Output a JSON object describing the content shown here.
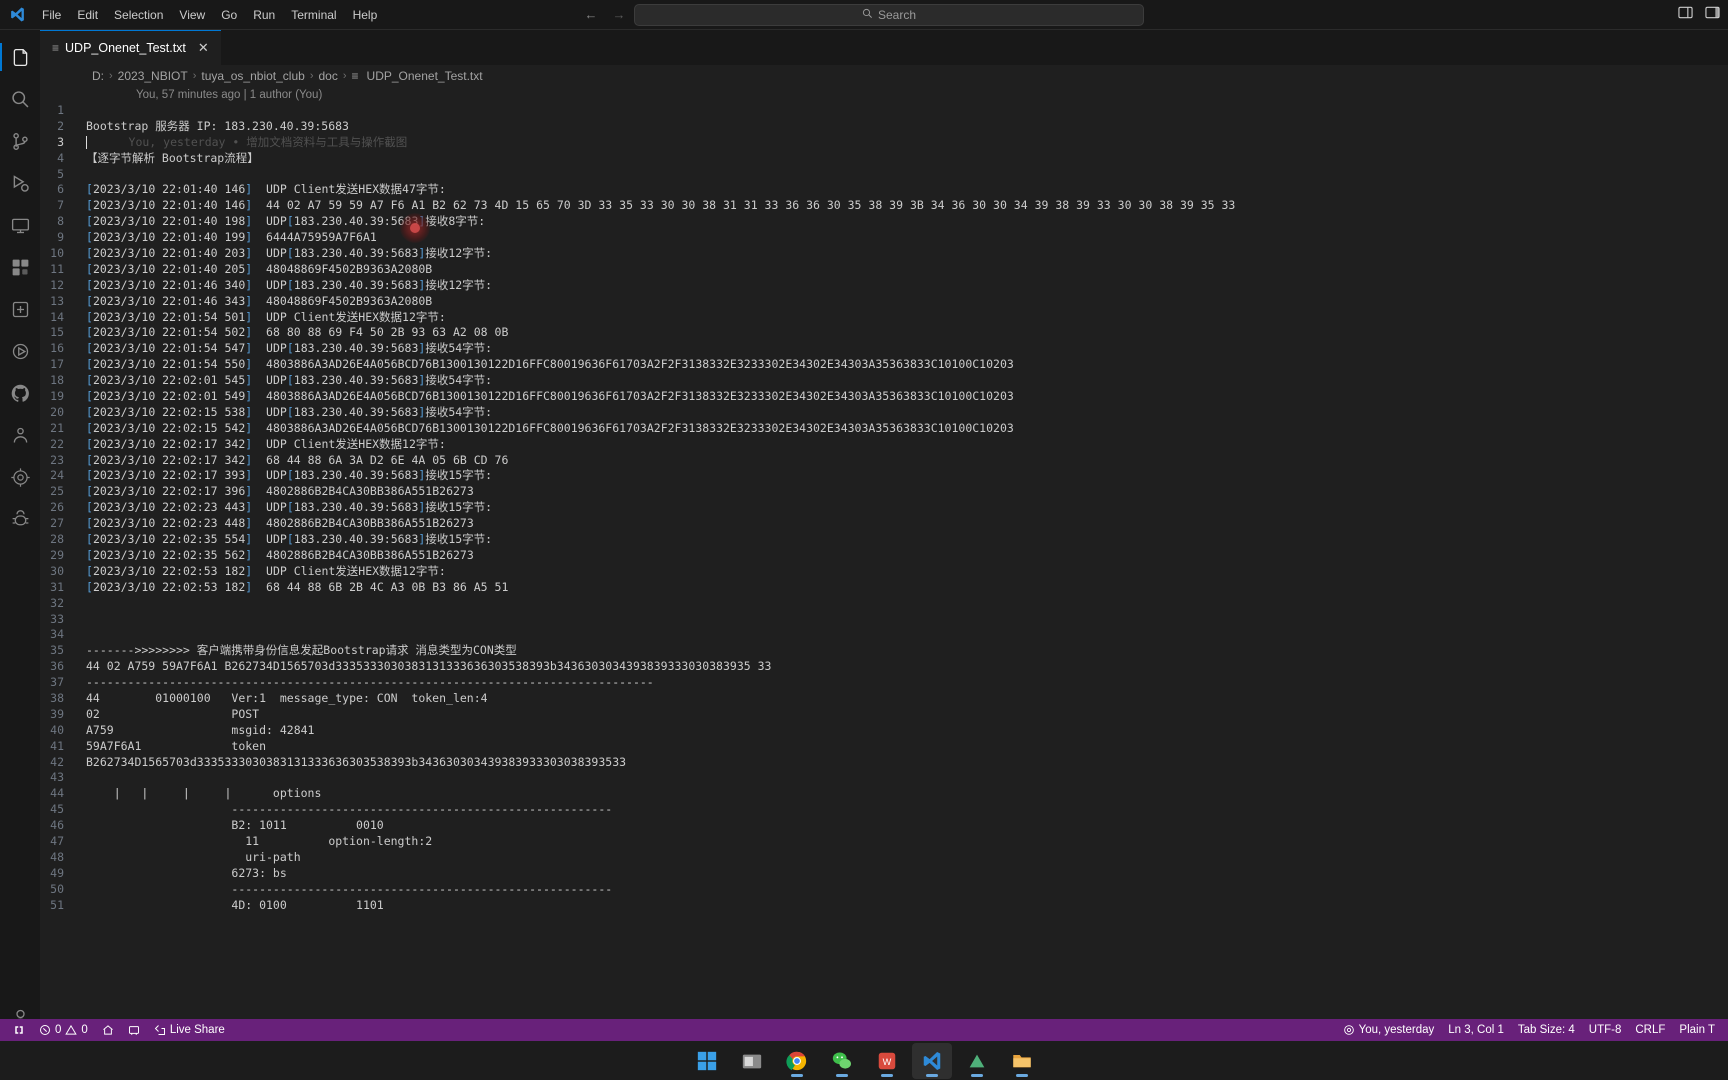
{
  "window": {
    "app": "Visual Studio Code"
  },
  "titlebar": {
    "menus": [
      "File",
      "Edit",
      "Selection",
      "View",
      "Go",
      "Run",
      "Terminal",
      "Help"
    ],
    "nav_back": "←",
    "nav_forward": "→",
    "search_placeholder": "Search",
    "search_icon": "search-icon",
    "layout_icon": "toggle-panel-icon",
    "customize_icon": "customize-layout-icon"
  },
  "activitybar": {
    "items": [
      {
        "name": "explorer",
        "icon": "files-icon",
        "active": true
      },
      {
        "name": "search",
        "icon": "search-icon",
        "active": false
      },
      {
        "name": "source-control",
        "icon": "source-control-icon",
        "active": false
      },
      {
        "name": "run-and-debug",
        "icon": "run-debug-icon",
        "active": false
      },
      {
        "name": "remote-explorer",
        "icon": "remote-explorer-icon",
        "active": false
      },
      {
        "name": "extensions",
        "icon": "extensions-icon",
        "active": false
      },
      {
        "name": "test-explorer",
        "icon": "beaker-icon",
        "active": false
      },
      {
        "name": "embedded-tools",
        "icon": "circuit-icon",
        "active": false
      },
      {
        "name": "github",
        "icon": "github-icon",
        "active": false
      },
      {
        "name": "live-share",
        "icon": "live-share-icon",
        "active": false
      },
      {
        "name": "platformio",
        "icon": "platformio-icon",
        "active": false
      },
      {
        "name": "code-runner",
        "icon": "bug-icon",
        "active": false
      }
    ],
    "bottom_items": [
      {
        "name": "accounts",
        "icon": "account-icon"
      },
      {
        "name": "manage",
        "icon": "gear-icon"
      }
    ]
  },
  "tabs": [
    {
      "label": "UDP_Onenet_Test.txt",
      "icon": "text-file-icon",
      "active": true,
      "close": "✕"
    }
  ],
  "breadcrumb": {
    "items": [
      "D:",
      "2023_NBIOT",
      "tuya_os_nbiot_club",
      "doc",
      "UDP_Onenet_Test.txt"
    ],
    "separator": "›",
    "file_icon": "text-file-icon"
  },
  "codelens": {
    "text": "You, 57 minutes ago | 1 author (You)"
  },
  "editor": {
    "blame_line3": "You, yesterday • 增加文档资料与工具与操作截图",
    "lines": [
      {
        "n": 1,
        "text": ""
      },
      {
        "n": 2,
        "text": "Bootstrap 服务器 IP: 183.230.40.39:5683"
      },
      {
        "n": 3,
        "text": "",
        "cursor": true
      },
      {
        "n": 4,
        "text": "【逐字节解析 Bootstrap流程】"
      },
      {
        "n": 5,
        "text": ""
      },
      {
        "n": 6,
        "text": "[2023/3/10 22:01:40 146]  UDP Client发送HEX数据47字节:"
      },
      {
        "n": 7,
        "text": "[2023/3/10 22:01:40 146]  44 02 A7 59 59 A7 F6 A1 B2 62 73 4D 15 65 70 3D 33 35 33 30 30 38 31 31 33 36 36 30 35 38 39 3B 34 36 30 30 34 39 38 39 33 30 30 38 39 35 33"
      },
      {
        "n": 8,
        "text": "[2023/3/10 22:01:40 198]  UDP[183.230.40.39:5683]接收8字节:"
      },
      {
        "n": 9,
        "text": "[2023/3/10 22:01:40 199]  6444A75959A7F6A1"
      },
      {
        "n": 10,
        "text": "[2023/3/10 22:01:40 203]  UDP[183.230.40.39:5683]接收12字节:"
      },
      {
        "n": 11,
        "text": "[2023/3/10 22:01:40 205]  48048869F4502B9363A2080B"
      },
      {
        "n": 12,
        "text": "[2023/3/10 22:01:46 340]  UDP[183.230.40.39:5683]接收12字节:"
      },
      {
        "n": 13,
        "text": "[2023/3/10 22:01:46 343]  48048869F4502B9363A2080B"
      },
      {
        "n": 14,
        "text": "[2023/3/10 22:01:54 501]  UDP Client发送HEX数据12字节:"
      },
      {
        "n": 15,
        "text": "[2023/3/10 22:01:54 502]  68 80 88 69 F4 50 2B 93 63 A2 08 0B"
      },
      {
        "n": 16,
        "text": "[2023/3/10 22:01:54 547]  UDP[183.230.40.39:5683]接收54字节:"
      },
      {
        "n": 17,
        "text": "[2023/3/10 22:01:54 550]  4803886A3AD26E4A056BCD76B1300130122D16FFC80019636F61703A2F2F3138332E3233302E34302E34303A35363833C10100C10203"
      },
      {
        "n": 18,
        "text": "[2023/3/10 22:02:01 545]  UDP[183.230.40.39:5683]接收54字节:"
      },
      {
        "n": 19,
        "text": "[2023/3/10 22:02:01 549]  4803886A3AD26E4A056BCD76B1300130122D16FFC80019636F61703A2F2F3138332E3233302E34302E34303A35363833C10100C10203"
      },
      {
        "n": 20,
        "text": "[2023/3/10 22:02:15 538]  UDP[183.230.40.39:5683]接收54字节:"
      },
      {
        "n": 21,
        "text": "[2023/3/10 22:02:15 542]  4803886A3AD26E4A056BCD76B1300130122D16FFC80019636F61703A2F2F3138332E3233302E34302E34303A35363833C10100C10203"
      },
      {
        "n": 22,
        "text": "[2023/3/10 22:02:17 342]  UDP Client发送HEX数据12字节:"
      },
      {
        "n": 23,
        "text": "[2023/3/10 22:02:17 342]  68 44 88 6A 3A D2 6E 4A 05 6B CD 76"
      },
      {
        "n": 24,
        "text": "[2023/3/10 22:02:17 393]  UDP[183.230.40.39:5683]接收15字节:"
      },
      {
        "n": 25,
        "text": "[2023/3/10 22:02:17 396]  4802886B2B4CA30BB386A551B26273"
      },
      {
        "n": 26,
        "text": "[2023/3/10 22:02:23 443]  UDP[183.230.40.39:5683]接收15字节:"
      },
      {
        "n": 27,
        "text": "[2023/3/10 22:02:23 448]  4802886B2B4CA30BB386A551B26273"
      },
      {
        "n": 28,
        "text": "[2023/3/10 22:02:35 554]  UDP[183.230.40.39:5683]接收15字节:"
      },
      {
        "n": 29,
        "text": "[2023/3/10 22:02:35 562]  4802886B2B4CA30BB386A551B26273"
      },
      {
        "n": 30,
        "text": "[2023/3/10 22:02:53 182]  UDP Client发送HEX数据12字节:"
      },
      {
        "n": 31,
        "text": "[2023/3/10 22:02:53 182]  68 44 88 6B 2B 4C A3 0B B3 86 A5 51"
      },
      {
        "n": 32,
        "text": ""
      },
      {
        "n": 33,
        "text": ""
      },
      {
        "n": 34,
        "text": ""
      },
      {
        "n": 35,
        "text": "------->>>>>>>> 客户端携带身份信息发起Bootstrap请求 消息类型为CON类型"
      },
      {
        "n": 36,
        "text": "44 02 A759 59A7F6A1 B262734D1565703d3335333030383131333636303538393b3436303034393839333030383935 33"
      },
      {
        "n": 37,
        "text": "----------------------------------------------------------------------------------"
      },
      {
        "n": 38,
        "text": "44        01000100   Ver:1  message_type: CON  token_len:4"
      },
      {
        "n": 39,
        "text": "02                   POST"
      },
      {
        "n": 40,
        "text": "A759                 msgid: 42841"
      },
      {
        "n": 41,
        "text": "59A7F6A1             token"
      },
      {
        "n": 42,
        "text": "B262734D1565703d3335333030383131333636303538393b343630303439383933303038393533"
      },
      {
        "n": 43,
        "text": ""
      },
      {
        "n": 44,
        "text": "    |   |     |     |      options"
      },
      {
        "n": 45,
        "text": "                     -------------------------------------------------------"
      },
      {
        "n": 46,
        "text": "                     B2: 1011          0010"
      },
      {
        "n": 47,
        "text": "                       11          option-length:2"
      },
      {
        "n": 48,
        "text": "                       uri-path"
      },
      {
        "n": 49,
        "text": "                     6273: bs"
      },
      {
        "n": 50,
        "text": "                     -------------------------------------------------------"
      },
      {
        "n": 51,
        "text": "                     4D: 0100          1101"
      }
    ]
  },
  "statusbar": {
    "left": [
      {
        "name": "remote-indicator",
        "icon": "remote-icon",
        "label": ""
      },
      {
        "name": "problems",
        "icon": "error-warning-icon",
        "label": "0  0"
      },
      {
        "name": "home-task",
        "icon": "home-icon",
        "label": ""
      },
      {
        "name": "serial-monitor",
        "icon": "plug-icon",
        "label": ""
      },
      {
        "name": "live-share",
        "icon": "live-share-icon",
        "label": "Live Share"
      }
    ],
    "errors": "0",
    "warnings": "0",
    "live_share": "Live Share",
    "right": [
      {
        "name": "git-blame",
        "icon": "git-icon",
        "label": "You, yesterday"
      },
      {
        "name": "editor-position",
        "label": "Ln 3, Col 1"
      },
      {
        "name": "tab-size",
        "label": "Tab Size: 4"
      },
      {
        "name": "encoding",
        "label": "UTF-8"
      },
      {
        "name": "eol",
        "label": "CRLF"
      },
      {
        "name": "language-mode",
        "label": "Plain T"
      }
    ]
  },
  "taskbar": {
    "apps": [
      {
        "name": "start",
        "icon": "windows-icon",
        "running": false
      },
      {
        "name": "file-explorer",
        "icon": "folder-icon",
        "running": false
      },
      {
        "name": "chrome",
        "icon": "chrome-icon",
        "running": true
      },
      {
        "name": "wechat",
        "icon": "wechat-icon",
        "running": true
      },
      {
        "name": "wps",
        "icon": "wps-icon",
        "running": true
      },
      {
        "name": "vscode",
        "icon": "vscode-icon",
        "running": true,
        "active": true
      },
      {
        "name": "source-insight",
        "icon": "source-insight-icon",
        "running": true
      },
      {
        "name": "file-manager",
        "icon": "file-manager-icon",
        "running": true
      }
    ]
  },
  "colors": {
    "accent": "#0078d4",
    "statusbar_bg": "#68217a",
    "editor_bg": "#1f1f1f",
    "chrome_bg": "#181818",
    "linenum": "#6e7681",
    "bracket_blue": "#569cd6",
    "number_green": "#b5cea8"
  }
}
